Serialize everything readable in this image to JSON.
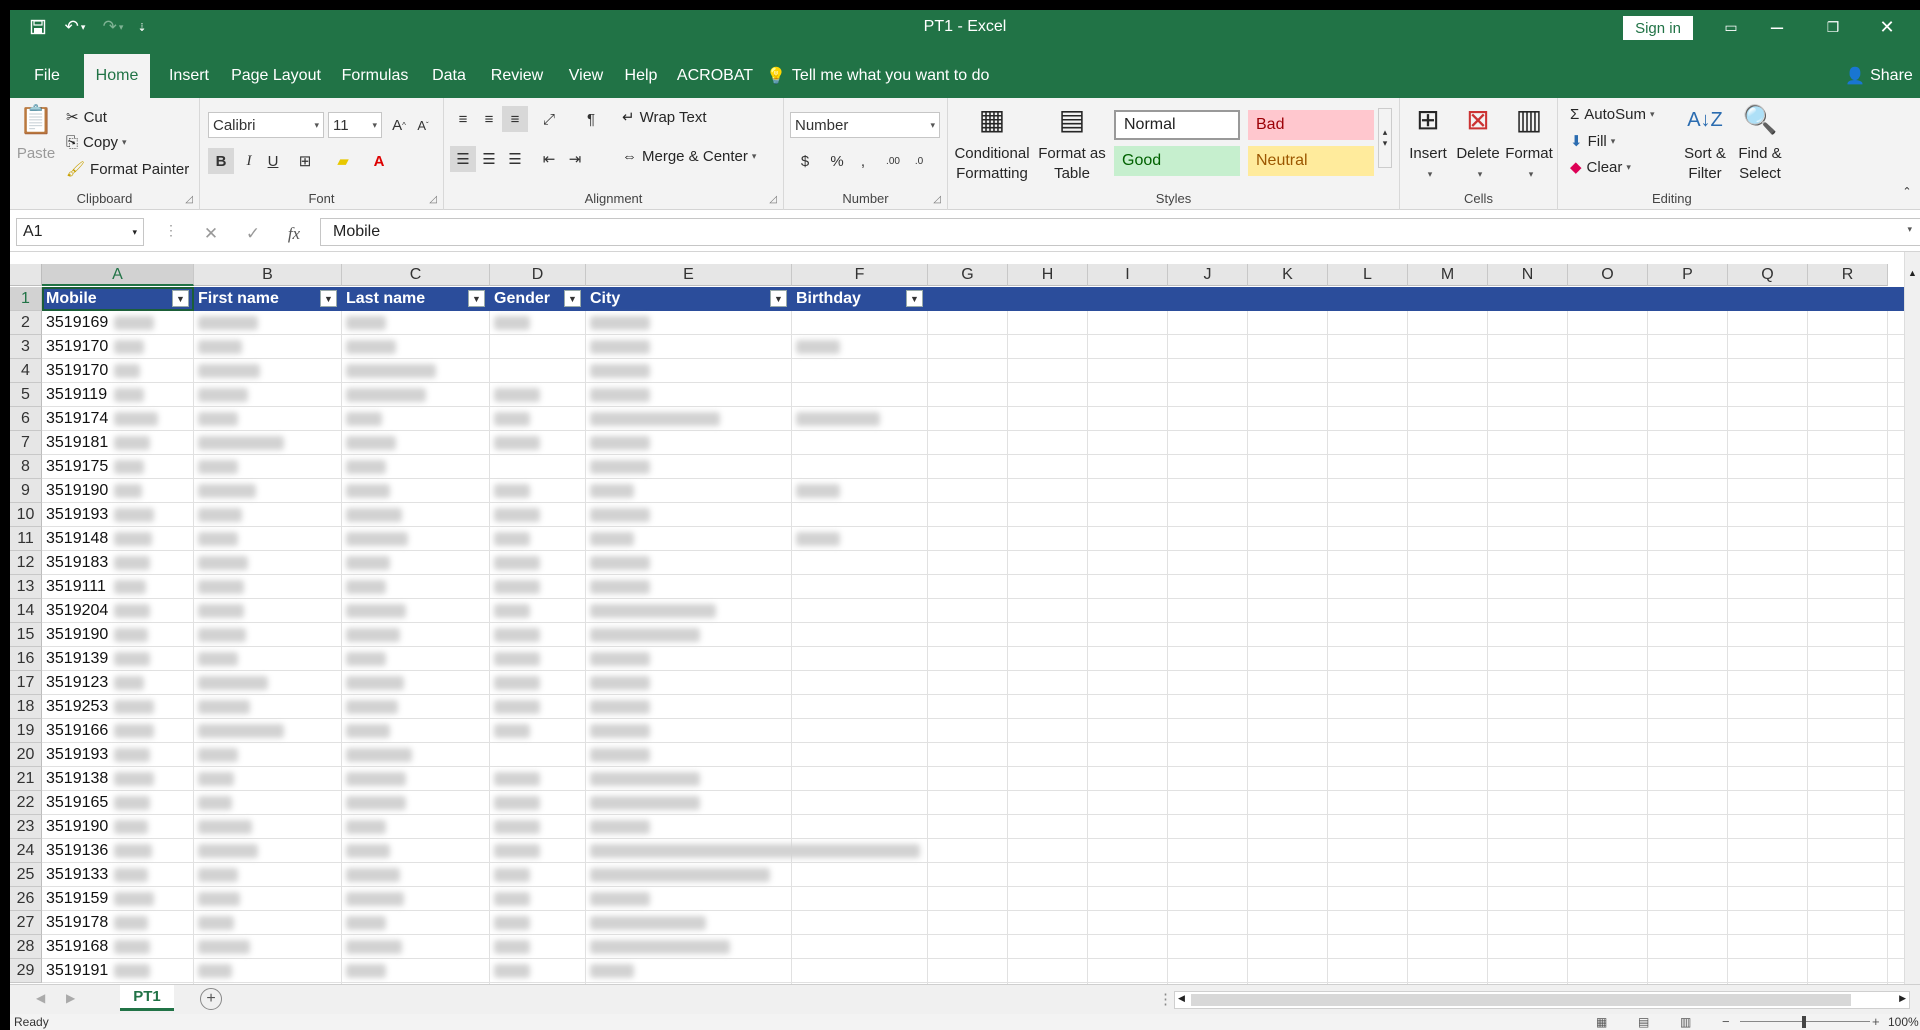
{
  "app": {
    "title": "PT1  -  Excel",
    "sign_in": "Sign in",
    "share": "Share"
  },
  "tabs": [
    "File",
    "Home",
    "Insert",
    "Page Layout",
    "Formulas",
    "Data",
    "Review",
    "View",
    "Help",
    "ACROBAT"
  ],
  "tell_me": "Tell me what you want to do",
  "clipboard": {
    "paste": "Paste",
    "cut": "Cut",
    "copy": "Copy",
    "format_painter": "Format Painter",
    "label": "Clipboard"
  },
  "font": {
    "name": "Calibri",
    "size": "11",
    "label": "Font"
  },
  "alignment": {
    "wrap": "Wrap Text",
    "merge": "Merge & Center",
    "label": "Alignment"
  },
  "number": {
    "format": "Number",
    "label": "Number"
  },
  "styles": {
    "conditional_1": "Conditional",
    "conditional_2": "Formatting",
    "table_1": "Format as",
    "table_2": "Table",
    "normal": "Normal",
    "bad": "Bad",
    "good": "Good",
    "neutral": "Neutral",
    "label": "Styles"
  },
  "cells": {
    "insert": "Insert",
    "delete": "Delete",
    "format": "Format",
    "label": "Cells"
  },
  "editing": {
    "autosum": "AutoSum",
    "fill": "Fill",
    "clear": "Clear",
    "sort_1": "Sort &",
    "sort_2": "Filter",
    "find_1": "Find &",
    "find_2": "Select",
    "label": "Editing"
  },
  "formula_bar": {
    "name_box": "A1",
    "content": "Mobile",
    "fx": "fx"
  },
  "columns": [
    "A",
    "B",
    "C",
    "D",
    "E",
    "F",
    "G",
    "H",
    "I",
    "J",
    "K",
    "L",
    "M",
    "N",
    "O",
    "P",
    "Q",
    "R"
  ],
  "table_headers": [
    "Mobile",
    "First name",
    "Last name",
    "Gender",
    "City",
    "Birthday"
  ],
  "rows": [
    {
      "n": "1"
    },
    {
      "n": "2",
      "a": "3519169"
    },
    {
      "n": "3",
      "a": "3519170"
    },
    {
      "n": "4",
      "a": "3519170"
    },
    {
      "n": "5",
      "a": "3519119"
    },
    {
      "n": "6",
      "a": "3519174"
    },
    {
      "n": "7",
      "a": "3519181"
    },
    {
      "n": "8",
      "a": "3519175"
    },
    {
      "n": "9",
      "a": "3519190"
    },
    {
      "n": "10",
      "a": "3519193"
    },
    {
      "n": "11",
      "a": "3519148"
    },
    {
      "n": "12",
      "a": "3519183"
    },
    {
      "n": "13",
      "a": "3519111"
    },
    {
      "n": "14",
      "a": "3519204"
    },
    {
      "n": "15",
      "a": "3519190"
    },
    {
      "n": "16",
      "a": "3519139"
    },
    {
      "n": "17",
      "a": "3519123"
    },
    {
      "n": "18",
      "a": "3519253"
    },
    {
      "n": "19",
      "a": "3519166"
    },
    {
      "n": "20",
      "a": "3519193"
    },
    {
      "n": "21",
      "a": "3519138"
    },
    {
      "n": "22",
      "a": "3519165"
    },
    {
      "n": "23",
      "a": "3519190"
    },
    {
      "n": "24",
      "a": "3519136"
    },
    {
      "n": "25",
      "a": "3519133"
    },
    {
      "n": "26",
      "a": "3519159"
    },
    {
      "n": "27",
      "a": "3519178"
    },
    {
      "n": "28",
      "a": "3519168"
    },
    {
      "n": "29",
      "a": "3519191"
    }
  ],
  "sheet": {
    "name": "PT1"
  },
  "status": {
    "ready": "Ready",
    "zoom": "100%"
  },
  "colors": {
    "excel_green": "#217346",
    "table_header": "#2b4d9b"
  }
}
